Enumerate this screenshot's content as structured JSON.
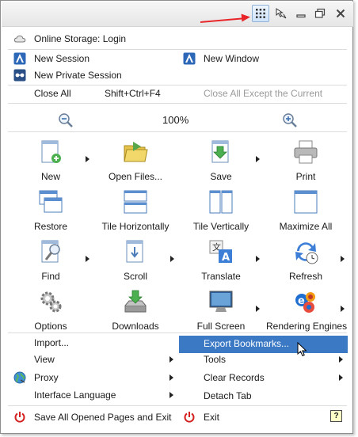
{
  "toolbar": {
    "icons": [
      "grid-menu-icon",
      "cursor-icon",
      "restore-icon",
      "close-icon"
    ]
  },
  "menu": {
    "online_storage": "Online Storage: Login",
    "new_session": "New Session",
    "new_window": "New Window",
    "new_private_session": "New Private Session",
    "close_all": "Close All",
    "close_all_shortcut": "Shift+Ctrl+F4",
    "close_all_except": "Close All Except the Current",
    "zoom_level": "100%",
    "grid": [
      {
        "label": "New",
        "icon": "new-page-icon",
        "submenu": true
      },
      {
        "label": "Open Files...",
        "icon": "open-folder-icon",
        "submenu": false
      },
      {
        "label": "Save",
        "icon": "save-icon",
        "submenu": true
      },
      {
        "label": "Print",
        "icon": "printer-icon",
        "submenu": false
      },
      {
        "label": "Restore",
        "icon": "restore-windows-icon",
        "submenu": false
      },
      {
        "label": "Tile Horizontally",
        "icon": "tile-horizontal-icon",
        "submenu": false
      },
      {
        "label": "Tile Vertically",
        "icon": "tile-vertical-icon",
        "submenu": false
      },
      {
        "label": "Maximize All",
        "icon": "maximize-all-icon",
        "submenu": false
      },
      {
        "label": "Find",
        "icon": "find-icon",
        "submenu": true
      },
      {
        "label": "Scroll",
        "icon": "scroll-icon",
        "submenu": true
      },
      {
        "label": "Translate",
        "icon": "translate-icon",
        "submenu": true
      },
      {
        "label": "Refresh",
        "icon": "refresh-icon",
        "submenu": true
      },
      {
        "label": "Options",
        "icon": "options-gears-icon",
        "submenu": false
      },
      {
        "label": "Downloads",
        "icon": "downloads-icon",
        "submenu": false
      },
      {
        "label": "Full Screen",
        "icon": "full-screen-icon",
        "submenu": true
      },
      {
        "label": "Rendering Engines",
        "icon": "rendering-engines-icon",
        "submenu": true
      }
    ],
    "import": "Import...",
    "export_bookmarks": "Export Bookmarks...",
    "view": "View",
    "tools": "Tools",
    "proxy": "Proxy",
    "clear_records": "Clear Records",
    "interface_language": "Interface Language",
    "detach_tab": "Detach Tab",
    "save_all_exit": "Save All Opened Pages and Exit",
    "exit": "Exit",
    "help_glyph": "?"
  },
  "colors": {
    "highlight": "#3b79c4",
    "arrow": "#e8262a",
    "exit_red": "#d42020"
  }
}
